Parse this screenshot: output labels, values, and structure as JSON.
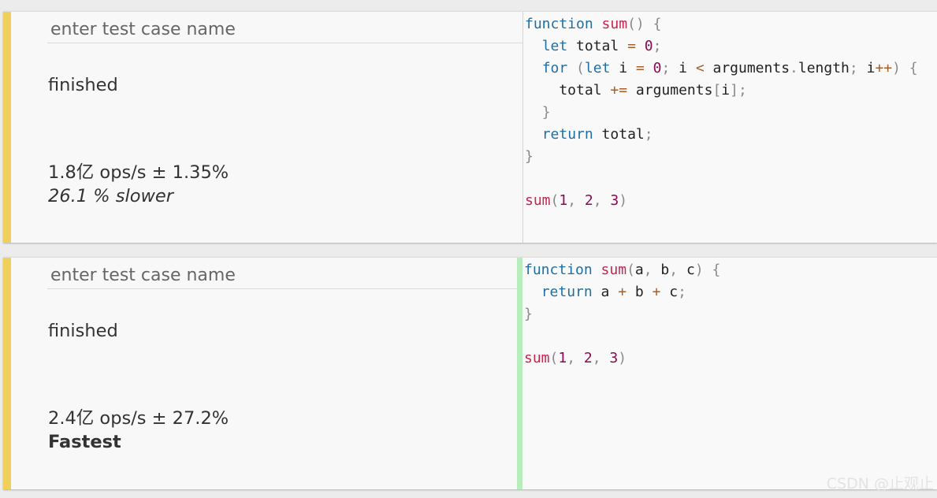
{
  "colors": {
    "accent_yellow": "#f0d05a",
    "accent_green": "#b8eebd",
    "keyword": "#1f6fa4",
    "function_name": "#c7254e",
    "number": "#8b0a50"
  },
  "test_cases": [
    {
      "name_placeholder": "enter test case name",
      "status": "finished",
      "ops": "1.8亿 ops/s ± 1.35%",
      "comparison": "26.1 % slower",
      "code_lines": [
        [
          {
            "t": "function",
            "c": "kw"
          },
          {
            "t": " "
          },
          {
            "t": "sum",
            "c": "fn"
          },
          {
            "t": "() {",
            "c": "pu"
          }
        ],
        [
          {
            "t": "  "
          },
          {
            "t": "let",
            "c": "kw"
          },
          {
            "t": " total "
          },
          {
            "t": "=",
            "c": "op"
          },
          {
            "t": " "
          },
          {
            "t": "0",
            "c": "num"
          },
          {
            "t": ";",
            "c": "pu"
          }
        ],
        [
          {
            "t": "  "
          },
          {
            "t": "for",
            "c": "kw"
          },
          {
            "t": " (",
            "c": "pu"
          },
          {
            "t": "let",
            "c": "kw"
          },
          {
            "t": " i "
          },
          {
            "t": "=",
            "c": "op"
          },
          {
            "t": " "
          },
          {
            "t": "0",
            "c": "num"
          },
          {
            "t": ";",
            "c": "pu"
          },
          {
            "t": " i "
          },
          {
            "t": "<",
            "c": "op"
          },
          {
            "t": " arguments"
          },
          {
            "t": ".",
            "c": "pu"
          },
          {
            "t": "length"
          },
          {
            "t": ";",
            "c": "pu"
          },
          {
            "t": " i"
          },
          {
            "t": "++",
            "c": "op"
          },
          {
            "t": ") {",
            "c": "pu"
          }
        ],
        [
          {
            "t": "    total "
          },
          {
            "t": "+=",
            "c": "op"
          },
          {
            "t": " arguments"
          },
          {
            "t": "[",
            "c": "pu"
          },
          {
            "t": "i"
          },
          {
            "t": "];",
            "c": "pu"
          }
        ],
        [
          {
            "t": "  "
          },
          {
            "t": "}",
            "c": "pu"
          }
        ],
        [
          {
            "t": "  "
          },
          {
            "t": "return",
            "c": "kw"
          },
          {
            "t": " total"
          },
          {
            "t": ";",
            "c": "pu"
          }
        ],
        [
          {
            "t": "}",
            "c": "pu"
          }
        ],
        [],
        [
          {
            "t": "sum",
            "c": "fn"
          },
          {
            "t": "(",
            "c": "pu"
          },
          {
            "t": "1",
            "c": "num"
          },
          {
            "t": ",",
            "c": "pu"
          },
          {
            "t": " "
          },
          {
            "t": "2",
            "c": "num"
          },
          {
            "t": ",",
            "c": "pu"
          },
          {
            "t": " "
          },
          {
            "t": "3",
            "c": "num"
          },
          {
            "t": ")",
            "c": "pu"
          }
        ]
      ]
    },
    {
      "name_placeholder": "enter test case name",
      "status": "finished",
      "ops": "2.4亿 ops/s ± 27.2%",
      "comparison": "Fastest",
      "code_lines": [
        [
          {
            "t": "function",
            "c": "kw"
          },
          {
            "t": " "
          },
          {
            "t": "sum",
            "c": "fn"
          },
          {
            "t": "(",
            "c": "pu"
          },
          {
            "t": "a"
          },
          {
            "t": ",",
            "c": "pu"
          },
          {
            "t": " b"
          },
          {
            "t": ",",
            "c": "pu"
          },
          {
            "t": " c"
          },
          {
            "t": ") {",
            "c": "pu"
          }
        ],
        [
          {
            "t": "  "
          },
          {
            "t": "return",
            "c": "kw"
          },
          {
            "t": " a "
          },
          {
            "t": "+",
            "c": "op"
          },
          {
            "t": " b "
          },
          {
            "t": "+",
            "c": "op"
          },
          {
            "t": " c"
          },
          {
            "t": ";",
            "c": "pu"
          }
        ],
        [
          {
            "t": "}",
            "c": "pu"
          }
        ],
        [],
        [
          {
            "t": "sum",
            "c": "fn"
          },
          {
            "t": "(",
            "c": "pu"
          },
          {
            "t": "1",
            "c": "num"
          },
          {
            "t": ",",
            "c": "pu"
          },
          {
            "t": " "
          },
          {
            "t": "2",
            "c": "num"
          },
          {
            "t": ",",
            "c": "pu"
          },
          {
            "t": " "
          },
          {
            "t": "3",
            "c": "num"
          },
          {
            "t": ")",
            "c": "pu"
          }
        ]
      ]
    }
  ],
  "watermark": "CSDN @止观止"
}
